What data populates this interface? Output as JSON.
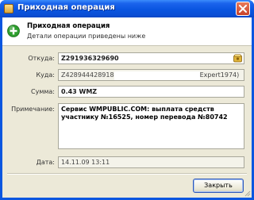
{
  "window": {
    "title": "Приходная операция"
  },
  "header": {
    "title": "Приходная операция",
    "subtitle": "Детали операции приведены ниже",
    "icon": "plus-icon"
  },
  "fields": {
    "from": {
      "label": "Откуда:",
      "value": "Z291936329690",
      "icon": "purse-icon"
    },
    "to": {
      "label": "Куда:",
      "value_start": "Z428944428918",
      "value_end": "Expert1974)"
    },
    "amount": {
      "label": "Сумма:",
      "value": "0.43 WMZ"
    },
    "note": {
      "label": "Примечание:",
      "lines": [
        "Сервис WMPUBLIC.COM: выплата средств",
        "участнику №16525, номер перевода №80742"
      ]
    },
    "date": {
      "label": "Дата:",
      "value": "14.11.09 13:11"
    }
  },
  "buttons": {
    "close_label": "Закрыть"
  },
  "colors": {
    "titlebar": "#0a55e0",
    "dialog_bg": "#ece9d8",
    "accent_green": "#2e9e2e"
  }
}
